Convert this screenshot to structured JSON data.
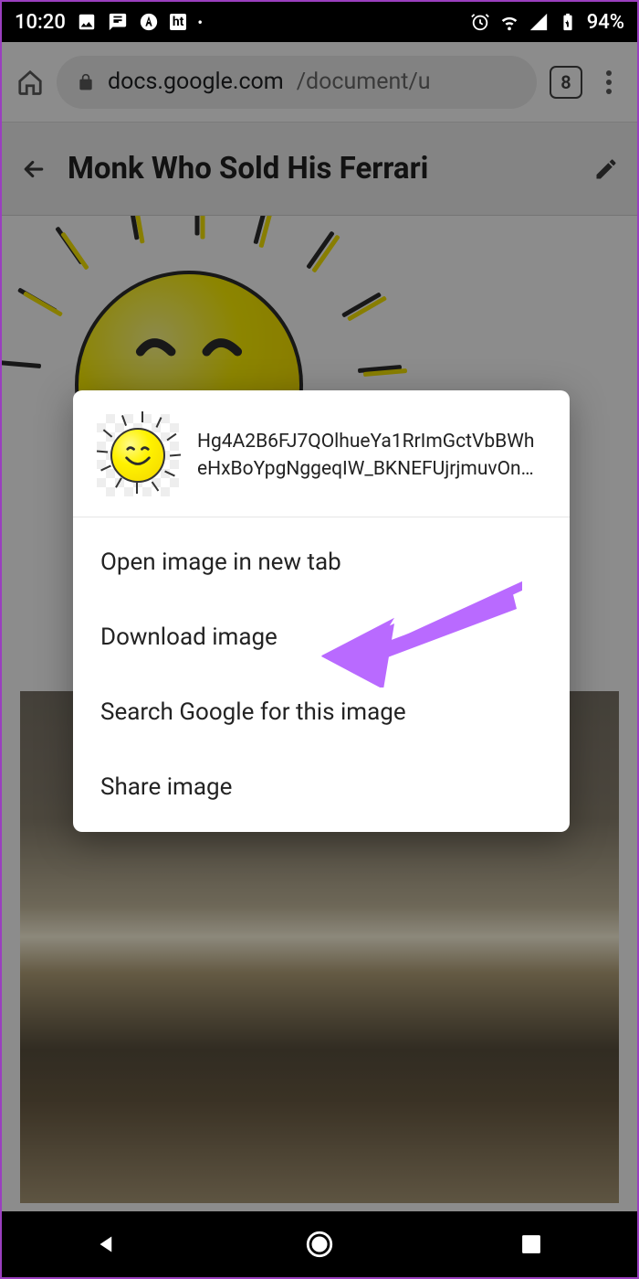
{
  "status": {
    "time": "10:20",
    "battery_text": "94%",
    "ht_label": "ht"
  },
  "browser": {
    "url_domain": "docs.google.com",
    "url_path": "/document/u",
    "tab_count": "8"
  },
  "doc": {
    "title": "Monk Who Sold His Ferrari"
  },
  "dialog": {
    "filename_line1": "Hg4A2B6FJ7QOlhueYa1RrImGctVbBWh",
    "filename_line2": "eHxBoYpgNggeqIW_BKNEFUjrjmuvOn…",
    "items": [
      "Open image in new tab",
      "Download image",
      "Search Google for this image",
      "Share image"
    ]
  },
  "annotation": {
    "arrow_color": "#b96aff",
    "target_item_index": 1
  }
}
